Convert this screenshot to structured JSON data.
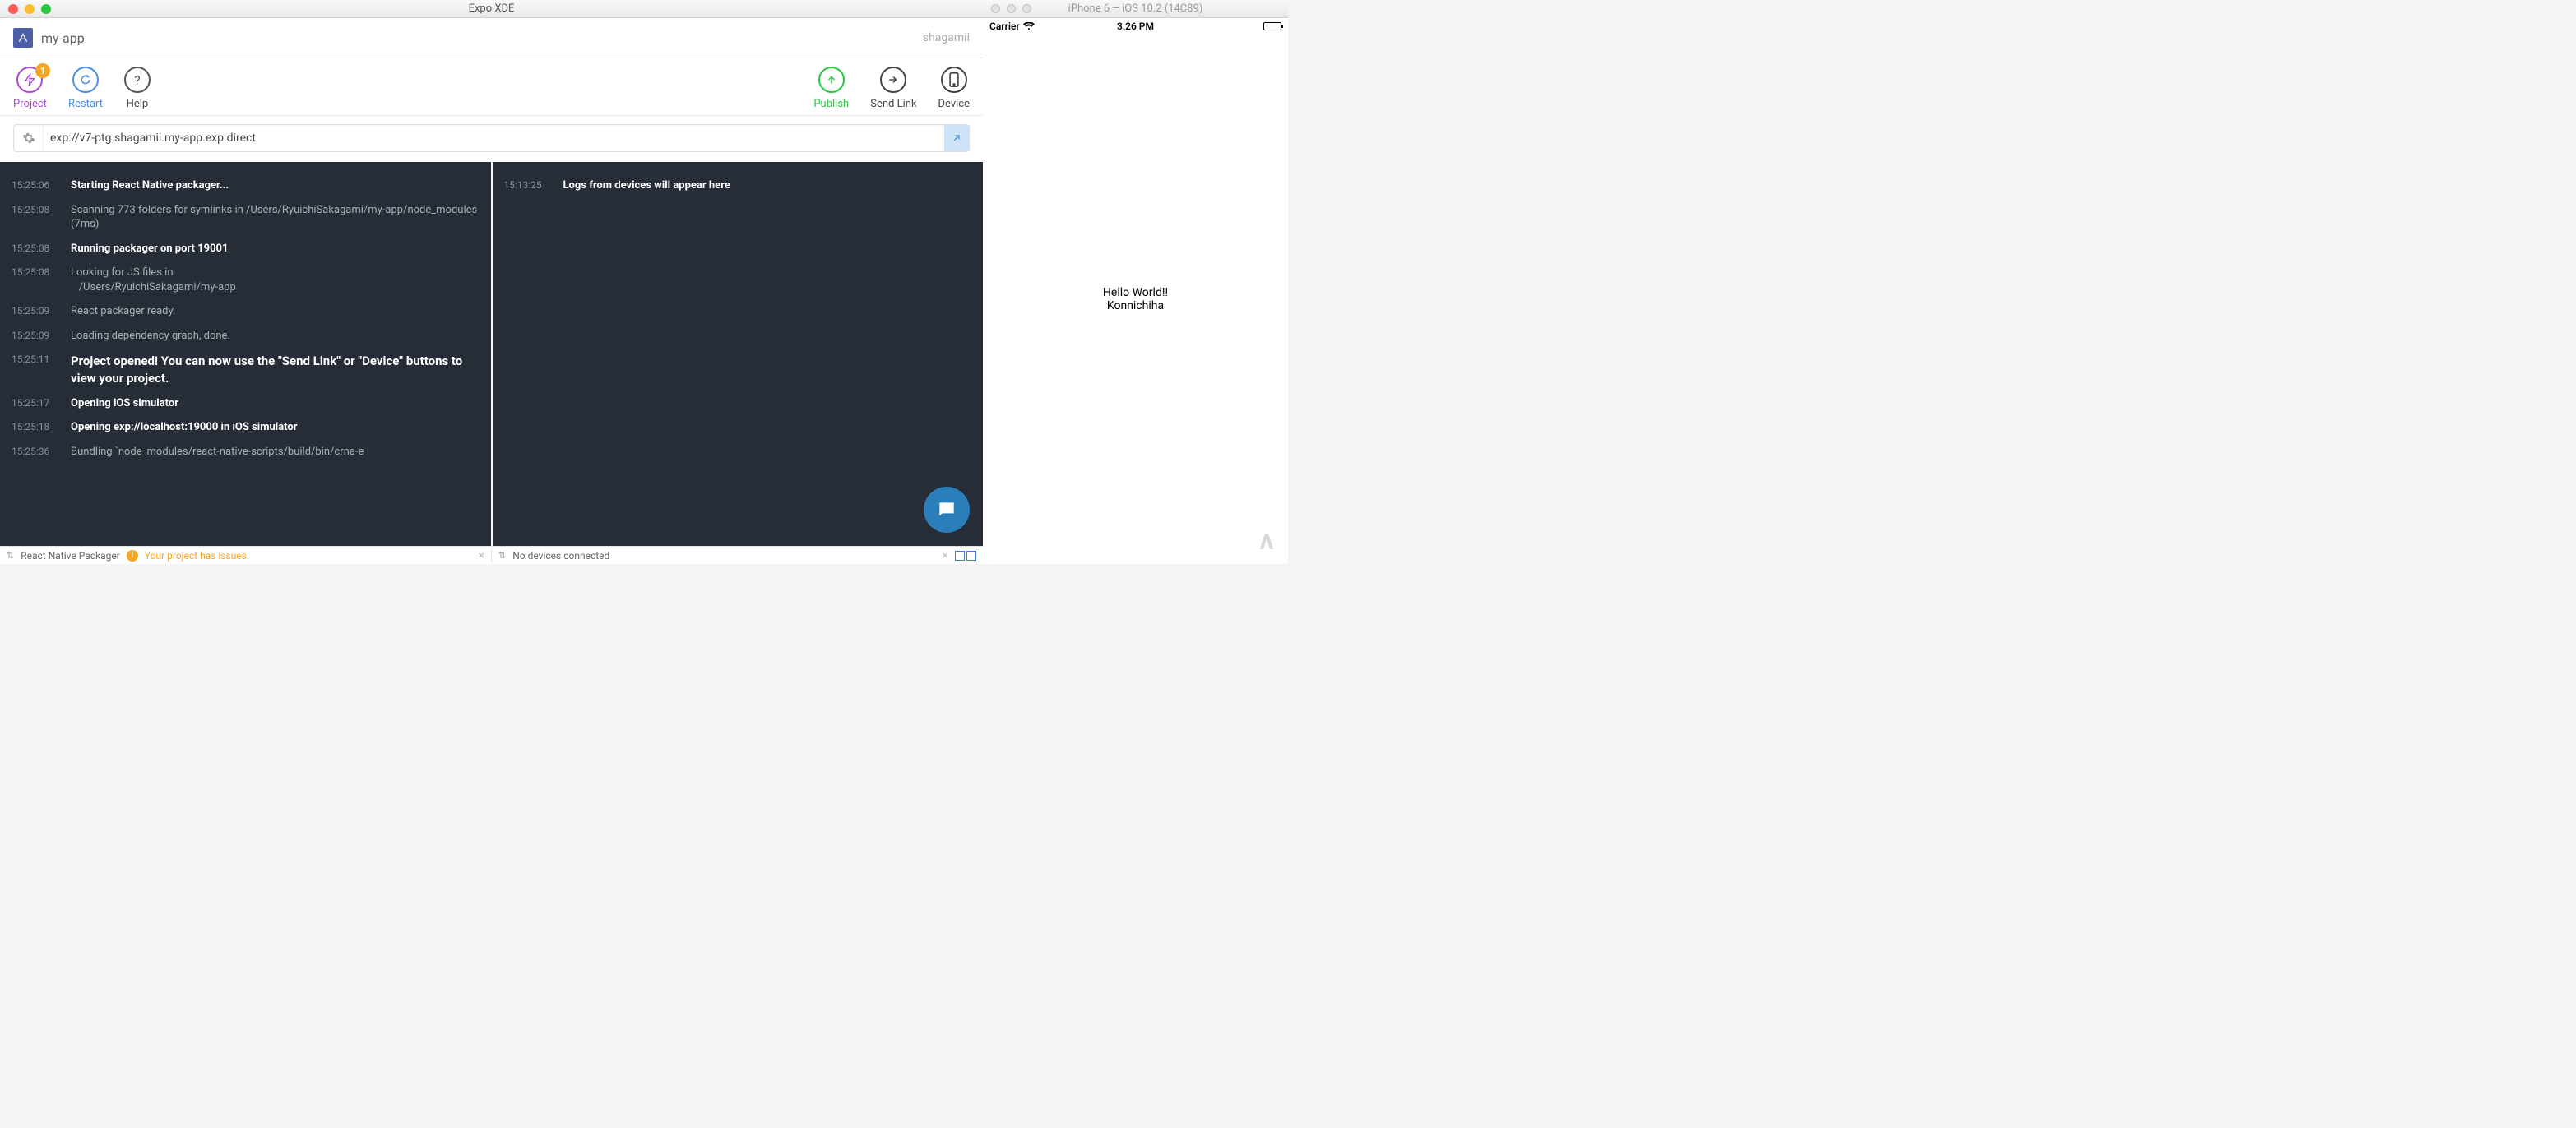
{
  "mainTitle": "Expo XDE",
  "simTitle": "iPhone 6 – iOS 10.2 (14C89)",
  "app": {
    "name": "my-app",
    "user": "shagamii"
  },
  "toolbar": {
    "project": {
      "label": "Project",
      "badge": "1"
    },
    "restart": {
      "label": "Restart"
    },
    "help": {
      "label": "Help"
    },
    "publish": {
      "label": "Publish"
    },
    "sendlink": {
      "label": "Send Link"
    },
    "device": {
      "label": "Device"
    }
  },
  "url": "exp://v7-ptg.shagamii.my-app.exp.direct",
  "logsLeft": [
    {
      "t": "15:25:06",
      "m": "Starting React Native packager...",
      "cls": "b"
    },
    {
      "t": "15:25:08",
      "m": "Scanning 773 folders for symlinks in /Users/RyuichiSakagami/my-app/node_modules (7ms)",
      "cls": "dim"
    },
    {
      "t": "15:25:08",
      "m": "Running packager on port 19001",
      "cls": "b"
    },
    {
      "t": "15:25:08",
      "m": "Looking for JS files in\n   /Users/RyuichiSakagami/my-app",
      "cls": "dim"
    },
    {
      "t": "15:25:09",
      "m": "React packager ready.",
      "cls": "dim"
    },
    {
      "t": "15:25:09",
      "m": "Loading dependency graph, done.",
      "cls": "dim"
    },
    {
      "t": "15:25:11",
      "m": "Project opened! You can now use the \"Send Link\" or \"Device\" buttons to view your project.",
      "cls": "big"
    },
    {
      "t": "15:25:17",
      "m": "Opening iOS simulator",
      "cls": "b"
    },
    {
      "t": "15:25:18",
      "m": "Opening exp://localhost:19000 in iOS simulator",
      "cls": "b"
    },
    {
      "t": "15:25:36",
      "m": "Bundling `node_modules/react-native-scripts/build/bin/crna-e",
      "cls": "dim"
    }
  ],
  "logsRight": [
    {
      "t": "15:13:25",
      "m": "Logs from devices will appear here",
      "cls": "b"
    }
  ],
  "status": {
    "left": "React Native Packager",
    "issues": "Your project has issues.",
    "right": "No devices connected"
  },
  "sim": {
    "carrier": "Carrier",
    "time": "3:26 PM",
    "line1": "Hello World!!",
    "line2": "Konnichiha"
  }
}
